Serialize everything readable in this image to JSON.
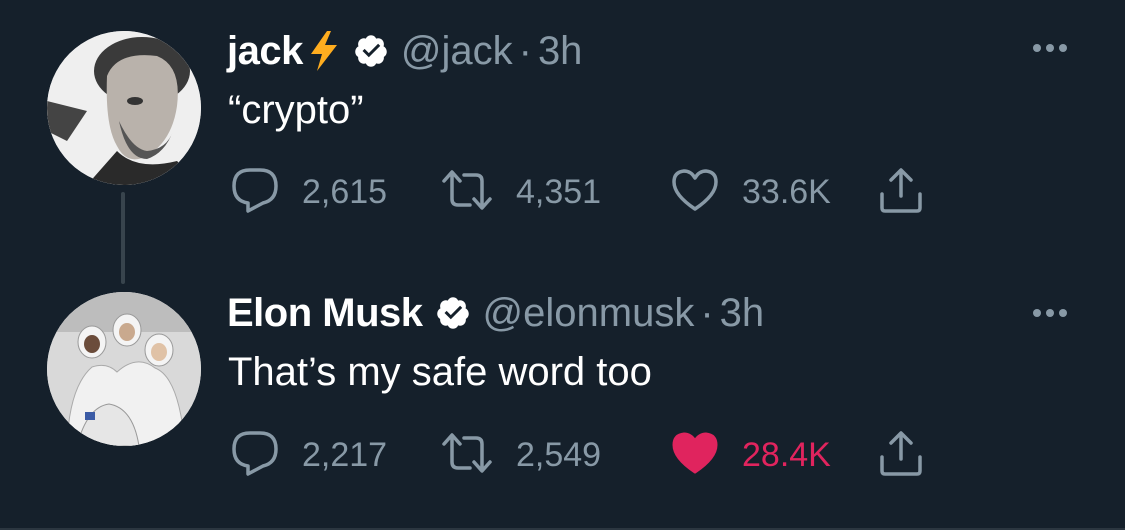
{
  "tweets": [
    {
      "name": "jack",
      "name_emoji": "lightning-bolt",
      "verified": true,
      "handle": "@jack",
      "separator": "·",
      "time": "3h",
      "text": "“crypto”",
      "replies": "2,615",
      "retweets": "4,351",
      "likes": "33.6K",
      "liked": false
    },
    {
      "name": "Elon Musk",
      "verified": true,
      "handle": "@elonmusk",
      "separator": "·",
      "time": "3h",
      "text": "That’s my safe word too",
      "replies": "2,217",
      "retweets": "2,549",
      "likes": "28.4K",
      "liked": true
    }
  ],
  "icons": {
    "reply": "speech-bubble-icon",
    "retweet": "retweet-icon",
    "like": "heart-icon",
    "share": "share-icon",
    "more": "more-dots-icon",
    "verified": "verified-badge-icon"
  },
  "colors": {
    "background": "#15202b",
    "secondary_text": "#8899a6",
    "like_active": "#e0245e",
    "verified_badge": "#ffffff",
    "bolt": "#ffad1f"
  }
}
